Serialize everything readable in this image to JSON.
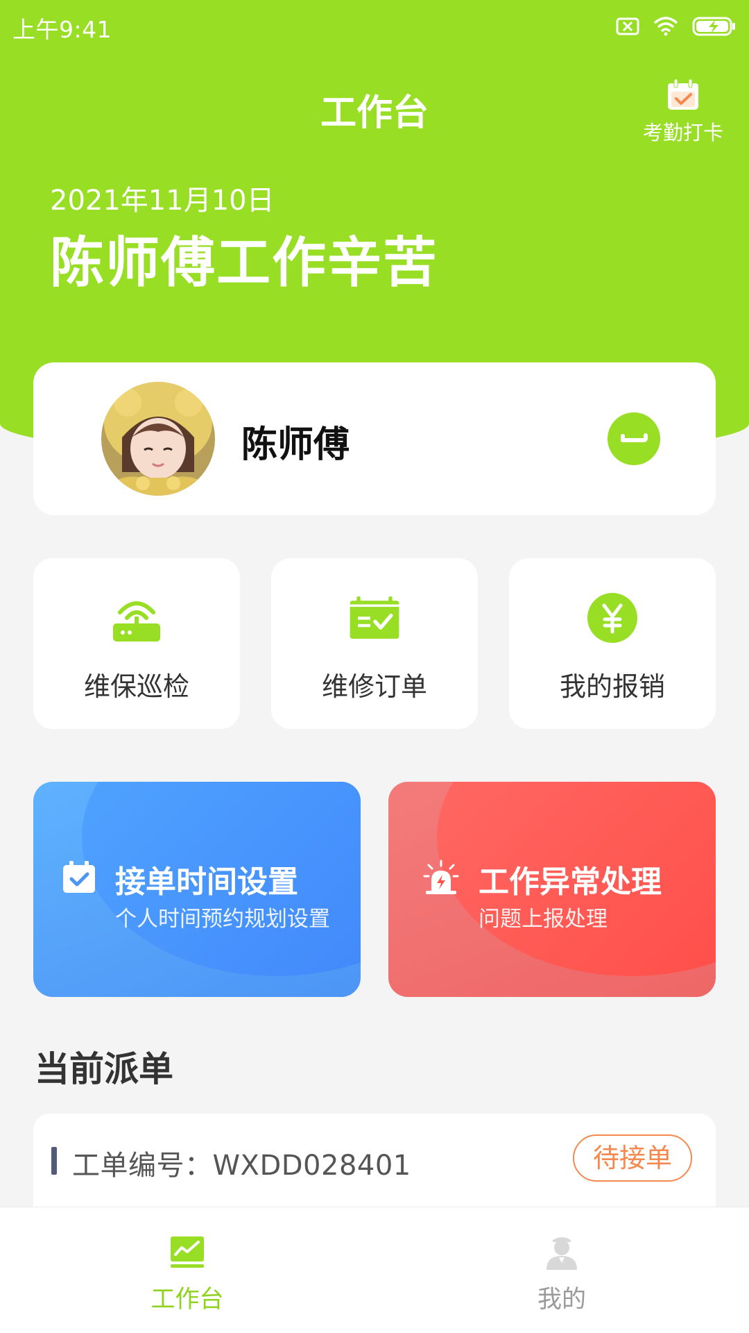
{
  "status_bar": {
    "time": "上午9:41"
  },
  "header": {
    "title": "工作台",
    "attendance_label": "考勤打卡",
    "date": "2021年11月10日",
    "greeting": "陈师傅工作辛苦"
  },
  "profile": {
    "name": "陈师傅"
  },
  "quick_actions": [
    {
      "label": "维保巡检",
      "icon": "router-icon"
    },
    {
      "label": "维修订单",
      "icon": "calendar-check-icon"
    },
    {
      "label": "我的报销",
      "icon": "yen-icon"
    }
  ],
  "banners": [
    {
      "title": "接单时间设置",
      "subtitle": "个人时间预约规划设置",
      "icon": "calendar-check-icon",
      "color": "#4d95f5"
    },
    {
      "title": "工作异常处理",
      "subtitle": "问题上报处理",
      "icon": "alarm-light-icon",
      "color": "#ff4a45"
    }
  ],
  "current_dispatch": {
    "section_title": "当前派单",
    "order_number": "工单编号：WXDD028401",
    "status": "待接单"
  },
  "bottom_nav": [
    {
      "label": "工作台",
      "active": true
    },
    {
      "label": "我的",
      "active": false
    }
  ],
  "colors": {
    "brand": "#97de24",
    "accent_orange": "#f5884e",
    "nav_active": "#8fd31f"
  }
}
